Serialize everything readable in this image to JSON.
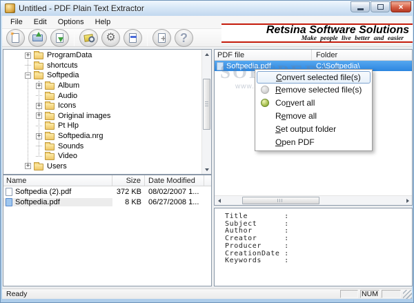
{
  "window": {
    "title": "Untitled - PDF Plain Text Extractor"
  },
  "menu": {
    "items": [
      "File",
      "Edit",
      "Options",
      "Help"
    ]
  },
  "toolbar": {
    "icons": [
      "new-document",
      "open-folder",
      "save",
      "convert",
      "settings-gears",
      "remove-page",
      "add-page",
      "help"
    ]
  },
  "banner": {
    "title": "Retsina Software Solutions",
    "tagline": "Make people live better and easier"
  },
  "tree": {
    "items": [
      {
        "label": "ProgramData"
      },
      {
        "label": "shortcuts"
      },
      {
        "label": "Softpedia"
      },
      {
        "label": "Album"
      },
      {
        "label": "Audio"
      },
      {
        "label": "Icons"
      },
      {
        "label": "Original images"
      },
      {
        "label": "Pt Hlp"
      },
      {
        "label": "Softpedia.nrg"
      },
      {
        "label": "Sounds"
      },
      {
        "label": "Video"
      },
      {
        "label": "Users"
      }
    ]
  },
  "file_list": {
    "columns": [
      "Name",
      "Size",
      "Date Modified"
    ],
    "rows": [
      {
        "name": "Softpedia (2).pdf",
        "size": "372 KB",
        "date": "08/02/2007 1..."
      },
      {
        "name": "Softpedia.pdf",
        "size": "8 KB",
        "date": "06/27/2008 1..."
      }
    ]
  },
  "pdf_list": {
    "columns": [
      "PDF file",
      "Folder"
    ],
    "rows": [
      {
        "file": "Softpedia.pdf",
        "folder": "C:\\Softpedia\\"
      }
    ]
  },
  "context_menu": {
    "items": [
      {
        "pre": "",
        "key": "C",
        "post": "onvert selected file(s)"
      },
      {
        "pre": "",
        "key": "R",
        "post": "emove selected file(s)"
      },
      {
        "pre": "Co",
        "key": "n",
        "post": "vert all"
      },
      {
        "pre": "R",
        "key": "e",
        "post": "move all"
      },
      {
        "pre": "",
        "key": "S",
        "post": "et output folder"
      },
      {
        "pre": "",
        "key": "O",
        "post": "pen PDF"
      }
    ]
  },
  "metadata": {
    "lines": [
      "Title        :",
      "Subject      :",
      "Author       :",
      "Creator      :",
      "Producer     :",
      "CreationDate :",
      "Keywords     :"
    ]
  },
  "status": {
    "ready": "Ready",
    "num": "NUM"
  },
  "watermark": {
    "line1": "SOFTPEDIA",
    "line2": "www.softpedia.com"
  }
}
